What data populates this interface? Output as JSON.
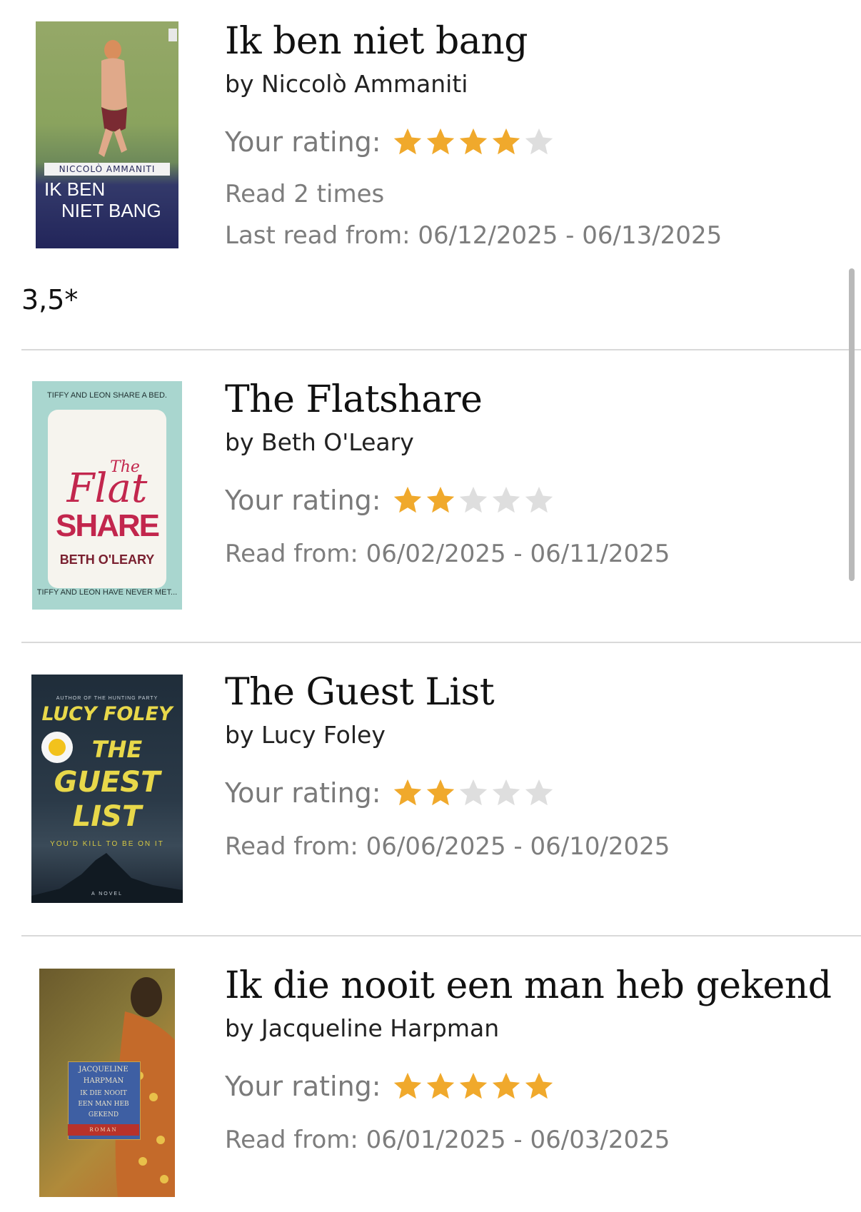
{
  "rating_label": "Your rating:",
  "note": "3,5*",
  "colors": {
    "star_filled": "#f0a92c",
    "star_empty": "#dedede",
    "secondary_text": "#7d7d7d"
  },
  "books": [
    {
      "title": "Ik ben niet bang",
      "author": "by Niccolò Ammaniti",
      "rating": 4,
      "max_rating": 5,
      "meta_lines": [
        "Read 2 times",
        "Last read from: 06/12/2025 - 06/13/2025"
      ],
      "cover": {
        "author_text": "NICCOLÒ AMMANITI",
        "title_line1": "IK BEN",
        "title_line2": "NIET BANG"
      }
    },
    {
      "title": "The Flatshare",
      "author": "by Beth O'Leary",
      "rating": 2,
      "max_rating": 5,
      "meta_lines": [
        "Read from: 06/02/2025 - 06/11/2025"
      ],
      "cover": {
        "top_text": "TIFFY AND LEON SHARE A BED.",
        "title_the": "The",
        "title_flat": "Flat",
        "title_share": "SHARE",
        "author_text": "BETH O'LEARY",
        "bottom_text": "TIFFY AND LEON HAVE NEVER MET..."
      }
    },
    {
      "title": "The Guest List",
      "author": "by Lucy Foley",
      "rating": 2,
      "max_rating": 5,
      "meta_lines": [
        "Read from: 06/06/2025 - 06/10/2025"
      ],
      "cover": {
        "top_text": "AUTHOR OF THE HUNTING PARTY",
        "author_text": "LUCY FOLEY",
        "title_line1": "THE",
        "title_line2": "GUEST",
        "title_line3": "LIST",
        "tagline": "YOU'D KILL TO BE ON IT",
        "footer": "A NOVEL"
      }
    },
    {
      "title": "Ik die nooit een man heb gekend",
      "author": "by Jacqueline Harpman",
      "rating": 5,
      "max_rating": 5,
      "meta_lines": [
        "Read from: 06/01/2025 - 06/03/2025"
      ],
      "cover": {
        "author_line1": "JACQUELINE",
        "author_line2": "HARPMAN",
        "title_line1": "IK DIE NOOIT",
        "title_line2": "EEN MAN HEB",
        "title_line3": "GEKEND",
        "footer": "ROMAN"
      }
    }
  ]
}
